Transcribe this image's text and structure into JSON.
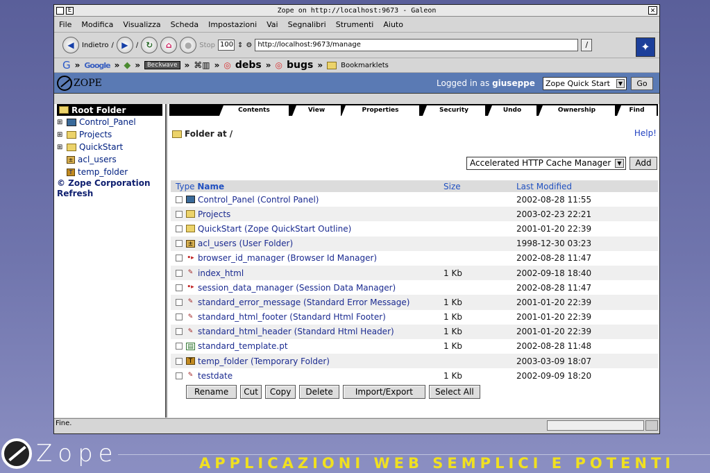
{
  "window": {
    "title": "Zope on http://localhost:9673 - Galeon",
    "btn_left": "E"
  },
  "menu": [
    "File",
    "Modifica",
    "Visualizza",
    "Scheda",
    "Impostazioni",
    "Vai",
    "Segnalibri",
    "Strumenti",
    "Aiuto"
  ],
  "nav": {
    "back_label": "Indietro",
    "stop_label": "Stop",
    "zoom": "100",
    "url": "http://localhost:9673/manage"
  },
  "bookmarks": [
    "Google",
    "Beckwave",
    "debs",
    "bugs",
    "Bookmarklets"
  ],
  "zope": {
    "logo": "ZOPE",
    "logged_prefix": "Logged in as",
    "user": "giuseppe",
    "quick": "Zope Quick Start",
    "go": "Go"
  },
  "tree": {
    "root": "Root Folder",
    "items": [
      "Control_Panel",
      "Projects",
      "QuickStart",
      "acl_users",
      "temp_folder"
    ],
    "copyright": "© Zope Corporation",
    "refresh": "Refresh"
  },
  "tabs": [
    "Contents",
    "View",
    "Properties",
    "Security",
    "Undo",
    "Ownership",
    "Find"
  ],
  "folder": {
    "label": "Folder at",
    "path": "/",
    "help": "Help!"
  },
  "add": {
    "selected": "Accelerated HTTP Cache Manager",
    "button": "Add"
  },
  "table": {
    "headers": {
      "type": "Type",
      "name": "Name",
      "size": "Size",
      "modified": "Last Modified"
    },
    "rows": [
      {
        "name": "Control_Panel (Control Panel)",
        "size": "",
        "modified": "2002-08-28 11:55",
        "icon": "cp"
      },
      {
        "name": "Projects",
        "size": "",
        "modified": "2003-02-23 22:21",
        "icon": "folder"
      },
      {
        "name": "QuickStart (Zope QuickStart Outline)",
        "size": "",
        "modified": "2001-01-20 22:39",
        "icon": "folder"
      },
      {
        "name": "acl_users (User Folder)",
        "size": "",
        "modified": "1998-12-30 03:23",
        "icon": "usr"
      },
      {
        "name": "browser_id_manager (Browser Id Manager)",
        "size": "",
        "modified": "2002-08-28 11:47",
        "icon": "arrows"
      },
      {
        "name": "index_html",
        "size": "1 Kb",
        "modified": "2002-09-18 18:40",
        "icon": "doc"
      },
      {
        "name": "session_data_manager (Session Data Manager)",
        "size": "",
        "modified": "2002-08-28 11:47",
        "icon": "arrows"
      },
      {
        "name": "standard_error_message (Standard Error Message)",
        "size": "1 Kb",
        "modified": "2001-01-20 22:39",
        "icon": "doc"
      },
      {
        "name": "standard_html_footer (Standard Html Footer)",
        "size": "1 Kb",
        "modified": "2001-01-20 22:39",
        "icon": "doc"
      },
      {
        "name": "standard_html_header (Standard Html Header)",
        "size": "1 Kb",
        "modified": "2001-01-20 22:39",
        "icon": "doc"
      },
      {
        "name": "standard_template.pt",
        "size": "1 Kb",
        "modified": "2002-08-28 11:48",
        "icon": "tpl"
      },
      {
        "name": "temp_folder (Temporary Folder)",
        "size": "",
        "modified": "2003-03-09 18:07",
        "icon": "tmp"
      },
      {
        "name": "testdate",
        "size": "1 Kb",
        "modified": "2002-09-09 18:20",
        "icon": "doc"
      }
    ]
  },
  "actions": [
    "Rename",
    "Cut",
    "Copy",
    "Delete",
    "Import/Export",
    "Select All"
  ],
  "status": "Fine.",
  "footer": {
    "logo": "Zope",
    "tagline": "APPLICAZIONI WEB SEMPLICI E POTENTI"
  }
}
